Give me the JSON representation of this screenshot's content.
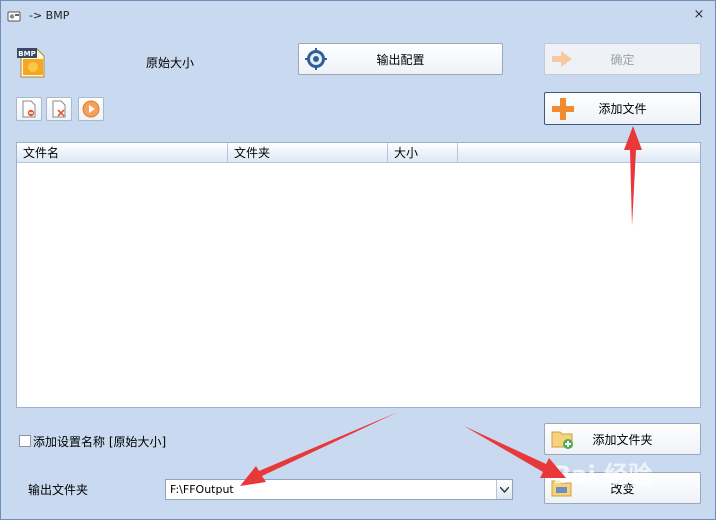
{
  "window": {
    "title": "-> BMP",
    "close_glyph": "×"
  },
  "top": {
    "format_badge": "BMP",
    "format_label": "原始大小",
    "output_config_label": "输出配置",
    "confirm_label": "确定",
    "add_file_label": "添加文件"
  },
  "file_table": {
    "columns": [
      "文件名",
      "文件夹",
      "大小"
    ],
    "rows": []
  },
  "options": {
    "add_setting_name_label": "添加设置名称 [原始大小]",
    "add_setting_name_checked": false
  },
  "output": {
    "folder_label": "输出文件夹",
    "folder_value": "F:\\FFOutput",
    "add_folder_label": "添加文件夹",
    "change_label": "改变"
  },
  "icons": {
    "app": "app-icon",
    "format": "bmp-format-icon",
    "output_config": "gear-icon",
    "confirm": "arrow-right-icon",
    "add_file": "plus-icon",
    "remove": "remove-file-icon",
    "clear": "clear-list-icon",
    "play": "play-icon",
    "add_folder": "folder-add-icon",
    "change": "folder-change-icon",
    "dropdown": "chevron-down-icon"
  },
  "colors": {
    "window_bg": "#c9daf0",
    "accent_orange": "#f28a2e",
    "annotation_red": "#e8383a"
  },
  "watermark": "Bai 经验"
}
